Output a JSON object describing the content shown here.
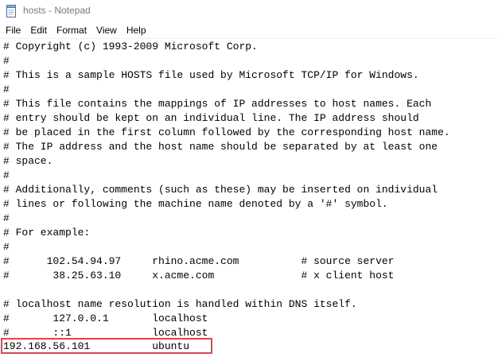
{
  "window": {
    "title": "hosts - Notepad",
    "icon": "notepad-icon"
  },
  "menu": {
    "items": [
      "File",
      "Edit",
      "Format",
      "View",
      "Help"
    ]
  },
  "editor": {
    "lines": [
      "# Copyright (c) 1993-2009 Microsoft Corp.",
      "#",
      "# This is a sample HOSTS file used by Microsoft TCP/IP for Windows.",
      "#",
      "# This file contains the mappings of IP addresses to host names. Each",
      "# entry should be kept on an individual line. The IP address should",
      "# be placed in the first column followed by the corresponding host name.",
      "# The IP address and the host name should be separated by at least one",
      "# space.",
      "#",
      "# Additionally, comments (such as these) may be inserted on individual",
      "# lines or following the machine name denoted by a '#' symbol.",
      "#",
      "# For example:",
      "#",
      "#      102.54.94.97     rhino.acme.com          # source server",
      "#       38.25.63.10     x.acme.com              # x client host",
      "",
      "# localhost name resolution is handled within DNS itself.",
      "#       127.0.0.1       localhost",
      "#       ::1             localhost",
      "192.168.56.101          ubuntu"
    ]
  },
  "colors": {
    "highlight_border": "#e0464e",
    "title_text": "#7a7a7a"
  }
}
